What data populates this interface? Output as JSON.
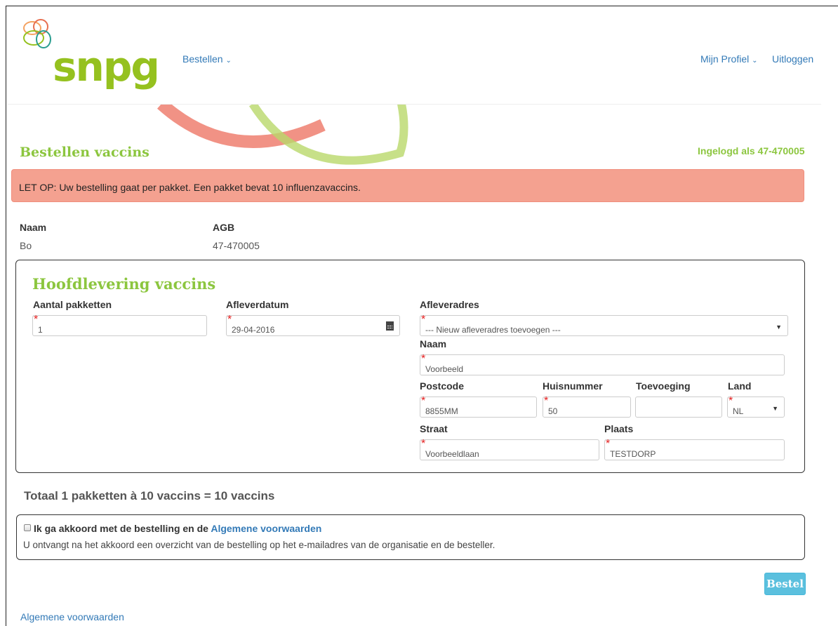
{
  "header": {
    "logo_text": "snpg",
    "nav_order": "Bestellen",
    "nav_profile": "Mijn Profiel",
    "nav_logout": "Uitloggen"
  },
  "page": {
    "title": "Bestellen vaccins",
    "logged_in": "Ingelogd als 47-470005",
    "alert": "LET OP: Uw bestelling gaat per pakket. Een pakket bevat 10 influenzavaccins."
  },
  "customer": {
    "name_label": "Naam",
    "name_value": "Bo",
    "agb_label": "AGB",
    "agb_value": "47-470005"
  },
  "delivery": {
    "title": "Hoofdlevering vaccins",
    "packages_label": "Aantal pakketten",
    "packages_value": "1",
    "date_label": "Afleverdatum",
    "date_value": "29-04-2016",
    "address_label": "Afleveradres",
    "address_selected": "--- Nieuw afleveradres toevoegen ---",
    "name_label": "Naam",
    "name_value": "Voorbeeld",
    "postcode_label": "Postcode",
    "postcode_value": "8855MM",
    "housenumber_label": "Huisnummer",
    "housenumber_value": "50",
    "addition_label": "Toevoeging",
    "addition_value": "",
    "country_label": "Land",
    "country_value": "NL",
    "street_label": "Straat",
    "street_value": "Voorbeeldlaan",
    "city_label": "Plaats",
    "city_value": "TESTDORP"
  },
  "summary": {
    "total": "Totaal 1 pakketten à 10 vaccins = 10 vaccins"
  },
  "agreement": {
    "checkbox_text": "Ik ga akkoord met de bestelling en de",
    "terms_link": "Algemene voorwaarden",
    "note": "U ontvangt na het akkoord een overzicht van de bestelling op het e-mailadres van de organisatie en de besteller."
  },
  "actions": {
    "order_button": "Bestel"
  },
  "footer": {
    "terms_link": "Algemene voorwaarden"
  },
  "colors": {
    "brand_green": "#95c11f",
    "alert_bg": "#f4a190",
    "link": "#337ab7",
    "button": "#5bc0de"
  }
}
